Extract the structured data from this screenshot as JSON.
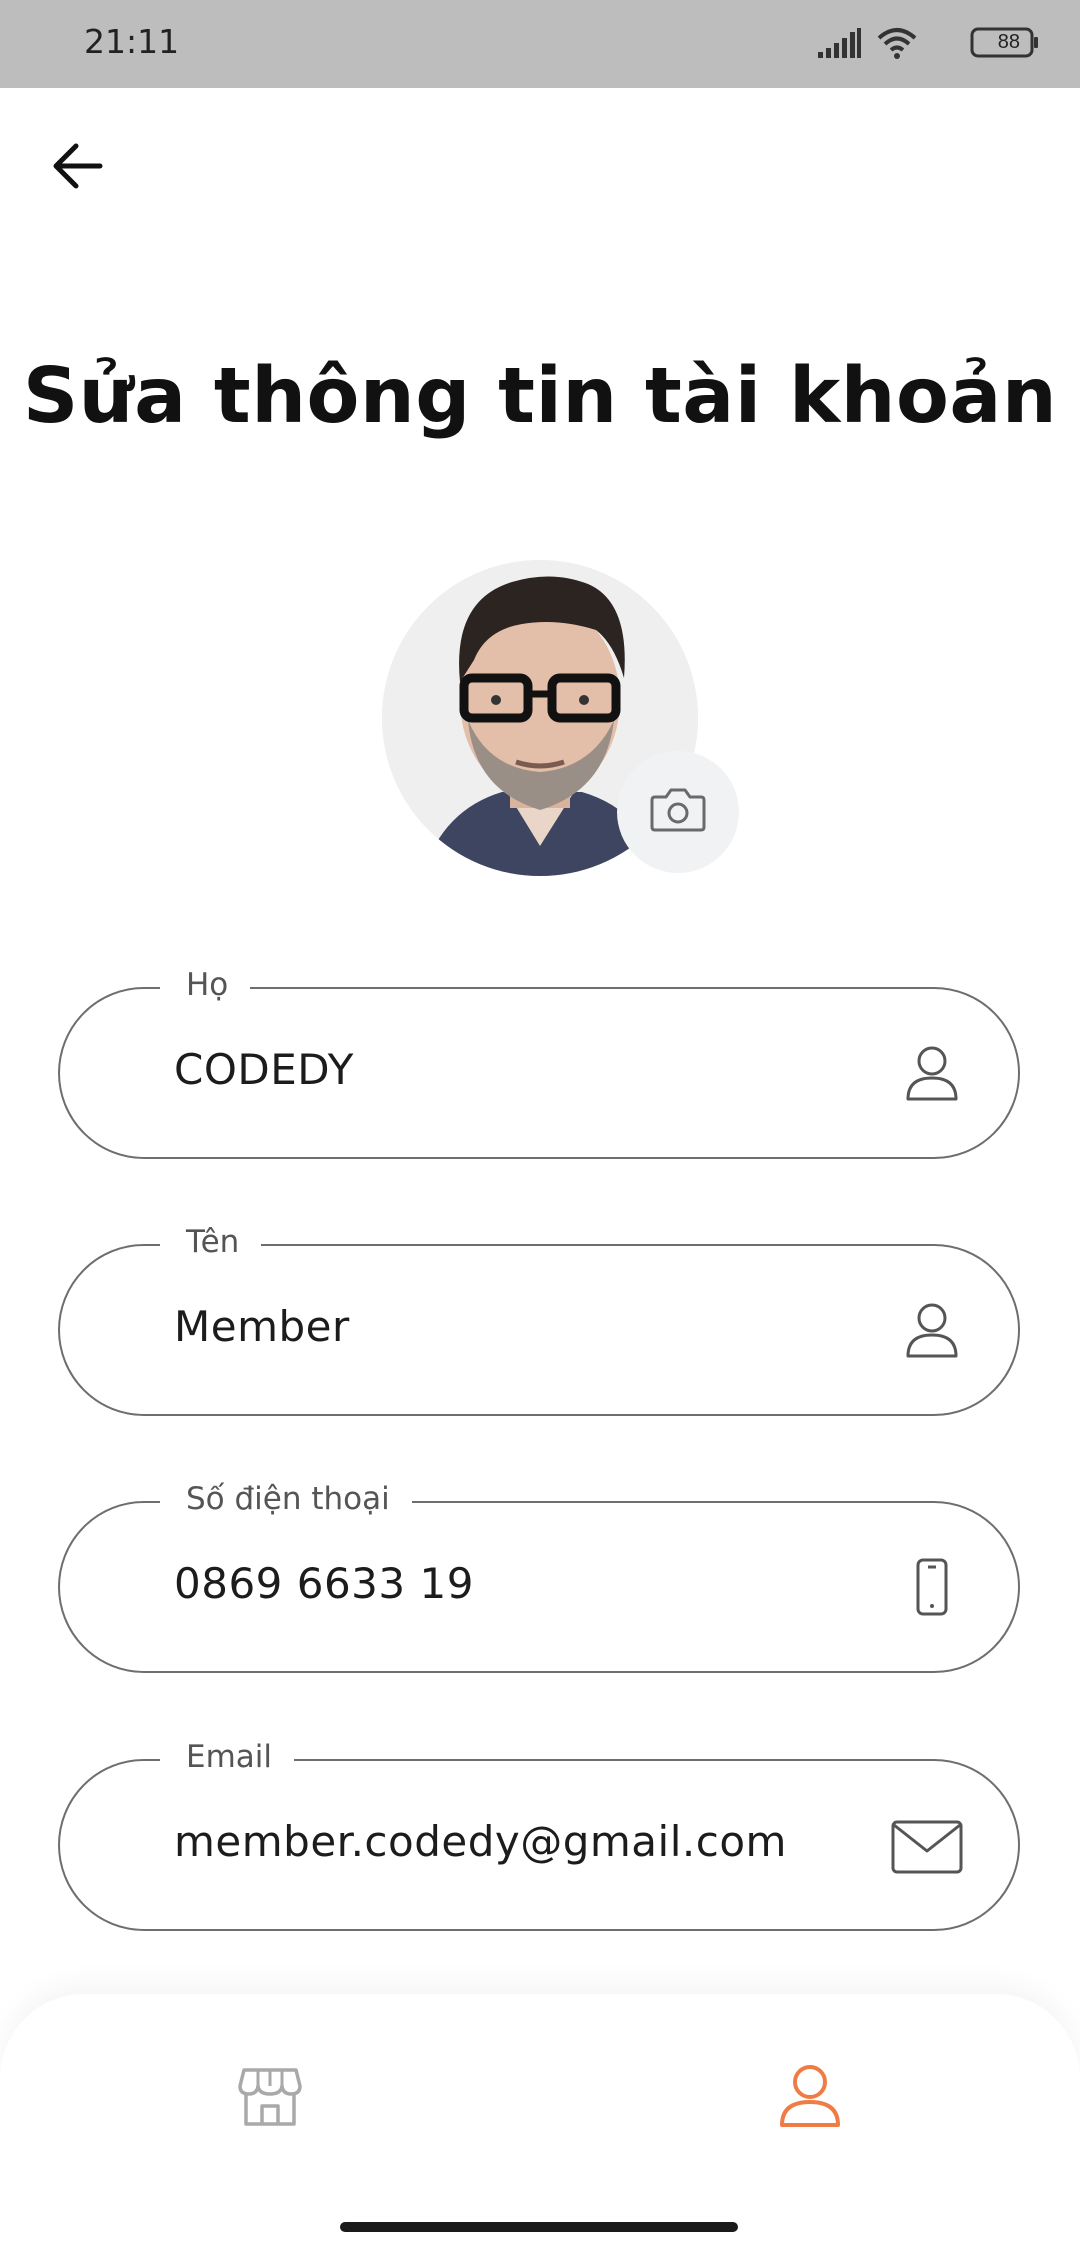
{
  "status_bar": {
    "time": "21:11",
    "battery": "88",
    "icons": [
      "signal-icon",
      "wifi-icon",
      "battery-icon"
    ]
  },
  "header": {
    "back_icon": "arrow-left-icon",
    "title": "Sửa thông tin tài khoản"
  },
  "profile": {
    "avatar": "avatar-photo",
    "camera_icon": "camera-icon"
  },
  "form": {
    "last_name": {
      "label": "Họ",
      "value": "CODEDY",
      "icon": "user-icon"
    },
    "first_name": {
      "label": "Tên",
      "value": "Member",
      "icon": "user-icon"
    },
    "phone": {
      "label": "Số điện thoại",
      "value": "0869 6633 19",
      "icon": "phone-icon"
    },
    "email": {
      "label": "Email",
      "value": "member.codedy@gmail.com",
      "icon": "mail-icon"
    }
  },
  "bottom_nav": {
    "items": [
      {
        "icon": "store-icon",
        "active": false
      },
      {
        "icon": "user-icon",
        "active": true
      }
    ]
  },
  "colors": {
    "accent": "#f07c45",
    "inactive": "#a9a9a9",
    "border": "#6e6e6e",
    "status_bar": "#bdbdbd"
  }
}
